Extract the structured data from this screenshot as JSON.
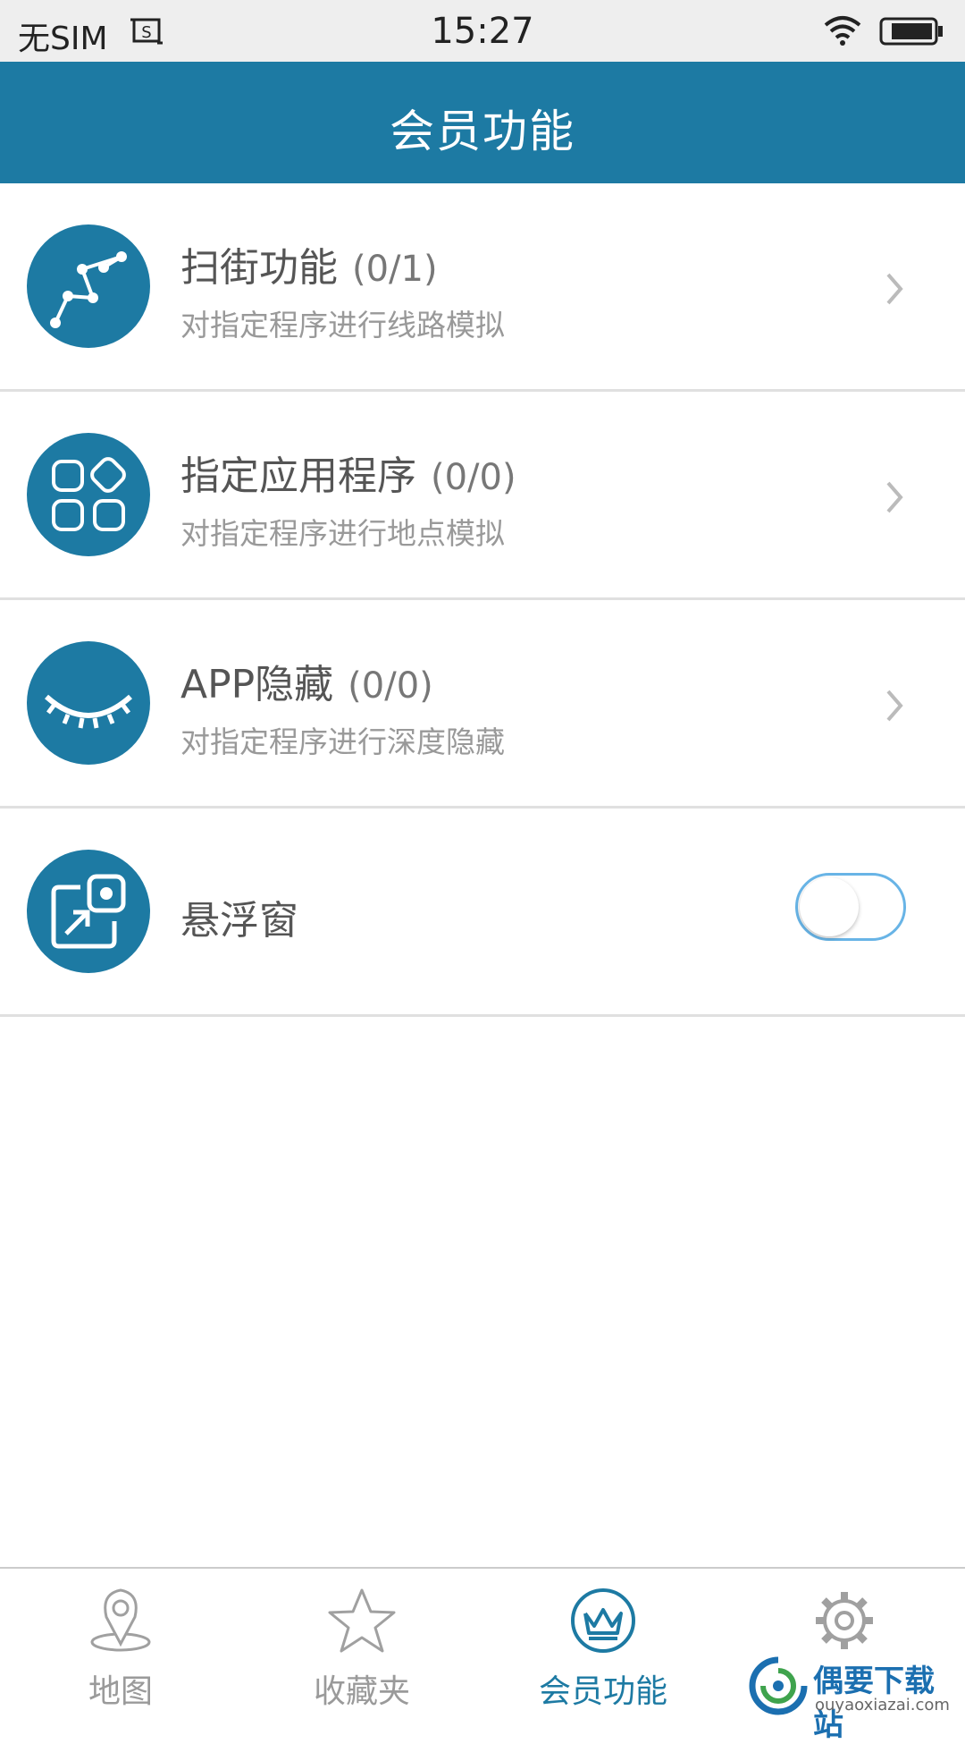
{
  "status_bar": {
    "carrier": "无SIM",
    "time": "15:27"
  },
  "header": {
    "title": "会员功能"
  },
  "features": [
    {
      "title": "扫街功能",
      "count": "(0/1)",
      "subtitle": "对指定程序进行线路模拟",
      "icon": "route-icon"
    },
    {
      "title": "指定应用程序",
      "count": "(0/0)",
      "subtitle": "对指定程序进行地点模拟",
      "icon": "apps-icon"
    },
    {
      "title": "APP隐藏",
      "count": "(0/0)",
      "subtitle": "对指定程序进行深度隐藏",
      "icon": "closed-eye-icon"
    }
  ],
  "floating_window": {
    "title": "悬浮窗",
    "icon": "floating-window-icon",
    "enabled": false
  },
  "tabs": [
    {
      "label": "地图",
      "icon": "map-pin-icon",
      "active": false
    },
    {
      "label": "收藏夹",
      "icon": "star-icon",
      "active": false
    },
    {
      "label": "会员功能",
      "icon": "crown-icon",
      "active": true
    },
    {
      "label": "",
      "icon": "gear-icon",
      "active": false
    }
  ],
  "watermark": {
    "title": "偶要下载站",
    "url": "ouyaoxiazai.com"
  },
  "colors": {
    "primary": "#1d7aa3",
    "toggle_border": "#68b4e6",
    "inactive_tab": "#9a9a9a"
  }
}
